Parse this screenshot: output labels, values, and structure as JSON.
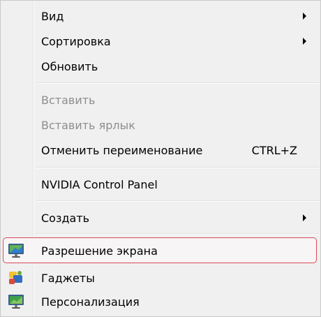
{
  "menu": {
    "items": [
      {
        "label": "Вид",
        "submenu": true
      },
      {
        "label": "Сортировка",
        "submenu": true
      },
      {
        "label": "Обновить"
      },
      {
        "label": "Вставить",
        "disabled": true
      },
      {
        "label": "Вставить ярлык",
        "disabled": true
      },
      {
        "label": "Отменить переименование",
        "shortcut": "CTRL+Z"
      },
      {
        "label": "NVIDIA Control Panel"
      },
      {
        "label": "Создать",
        "submenu": true
      },
      {
        "label": "Разрешение экрана",
        "icon": "display-resolution-icon",
        "highlighted": true
      },
      {
        "label": "Гаджеты",
        "icon": "gadgets-icon"
      },
      {
        "label": "Персонализация",
        "icon": "personalization-icon"
      }
    ]
  },
  "colors": {
    "highlight_border": "#d94a58",
    "disabled_text": "#8d8d8d"
  }
}
